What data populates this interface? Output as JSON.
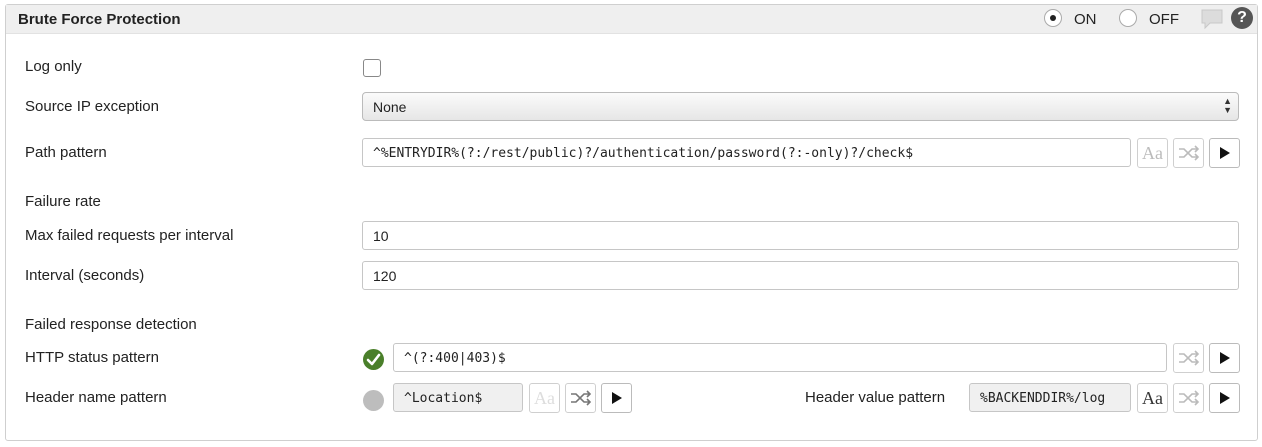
{
  "header": {
    "title": "Brute Force Protection",
    "on_label": "ON",
    "off_label": "OFF",
    "selected": "ON",
    "help_glyph": "?"
  },
  "fields": {
    "log_only": {
      "label": "Log only",
      "checked": false
    },
    "source_ip_exception": {
      "label": "Source IP exception",
      "value": "None"
    },
    "path_pattern": {
      "label": "Path pattern",
      "value": "^%ENTRYDIR%(?:/rest/public)?/authentication/password(?:-only)?/check$"
    },
    "failure_rate_section": "Failure rate",
    "max_failed": {
      "label": "Max failed requests per interval",
      "value": "10"
    },
    "interval": {
      "label": "Interval (seconds)",
      "value": "120"
    },
    "failed_response_section": "Failed response detection",
    "http_status": {
      "label": "HTTP status pattern",
      "value": "^(?:400|403)$",
      "status": "valid"
    },
    "header_name": {
      "label": "Header name pattern",
      "value": "^Location$",
      "status": "inactive"
    },
    "header_value": {
      "label": "Header value pattern",
      "value": "%BACKENDDIR%/log"
    }
  },
  "buttons": {
    "case_label": "Aa"
  },
  "icons": [
    "radio-on-icon",
    "radio-off-icon",
    "comment-icon",
    "help-icon",
    "shuffle-icon",
    "play-icon",
    "check-icon"
  ],
  "colors": {
    "ok": "#4a7f2a",
    "inactive": "#bdbdbd",
    "header_bg": "#efefef"
  }
}
